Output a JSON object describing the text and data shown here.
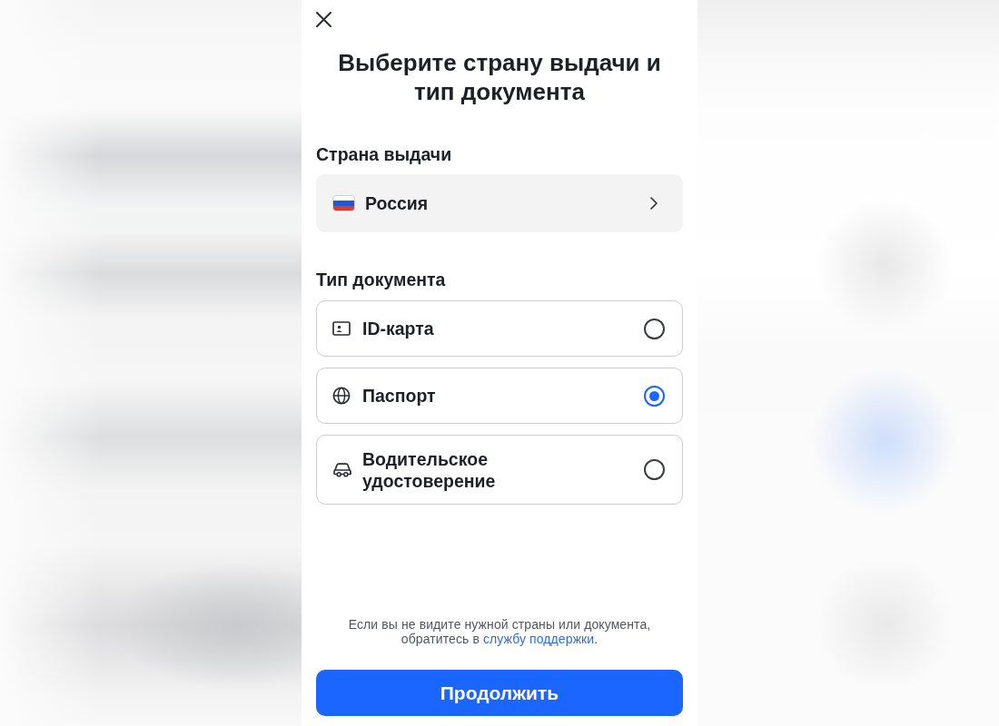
{
  "title": "Выберите страну выдачи и тип документа",
  "country_section": {
    "label": "Страна выдачи",
    "value": "Россия"
  },
  "document_section": {
    "label": "Тип документа",
    "options": [
      {
        "kind": "id-card",
        "label": "ID-карта",
        "selected": false
      },
      {
        "kind": "passport",
        "label": "Паспорт",
        "selected": true
      },
      {
        "kind": "license",
        "label": "Водительское удостоверение",
        "selected": false
      }
    ]
  },
  "footer": {
    "text_before": "Если вы не видите нужной страны или документа, обратитесь в",
    "link": "службу поддержки",
    "text_after": "."
  },
  "continue_button": "Продолжить"
}
